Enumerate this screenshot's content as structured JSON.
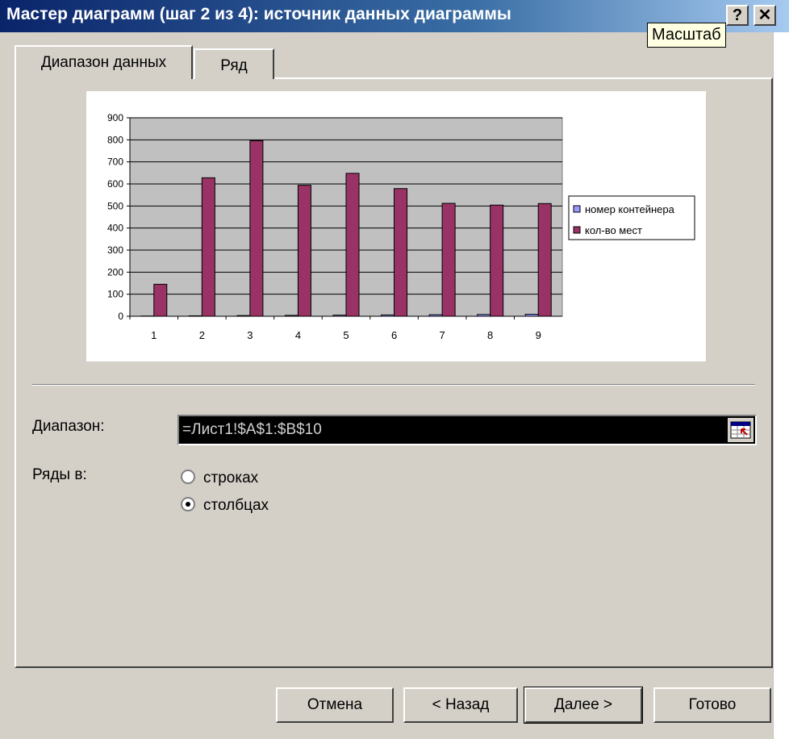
{
  "window": {
    "title": "Мастер диаграмм (шаг 2 из 4): источник данных диаграммы",
    "help_label": "?",
    "close_label": "✕",
    "tooltip": "Масштаб"
  },
  "tabs": [
    {
      "label": "Диапазон данных"
    },
    {
      "label": "Ряд"
    }
  ],
  "chart_data": {
    "type": "bar",
    "categories": [
      "1",
      "2",
      "3",
      "4",
      "5",
      "6",
      "7",
      "8",
      "9"
    ],
    "series": [
      {
        "name": "номер контейнера",
        "values": [
          1,
          2,
          3,
          4,
          5,
          6,
          7,
          8,
          9
        ],
        "color": "#9999ff"
      },
      {
        "name": "кол-во мест",
        "values": [
          145,
          628,
          796,
          594,
          648,
          579,
          512,
          504,
          511
        ],
        "color": "#993366"
      }
    ],
    "ylim": [
      0,
      900
    ],
    "yticks": [
      "0",
      "100",
      "200",
      "300",
      "400",
      "500",
      "600",
      "700",
      "800",
      "900"
    ],
    "grid": true,
    "legend": "right",
    "plot_bg": "#c0c0c0"
  },
  "form": {
    "range_label": "Диапазон:",
    "range_value": "=Лист1!$A$1:$B$10",
    "series_in_label": "Ряды в:",
    "options": [
      {
        "label": "строках",
        "selected": false
      },
      {
        "label": "столбцах",
        "selected": true
      }
    ]
  },
  "buttons": {
    "cancel": "Отмена",
    "back": "< Назад",
    "next": "Далее >",
    "finish": "Готово"
  }
}
